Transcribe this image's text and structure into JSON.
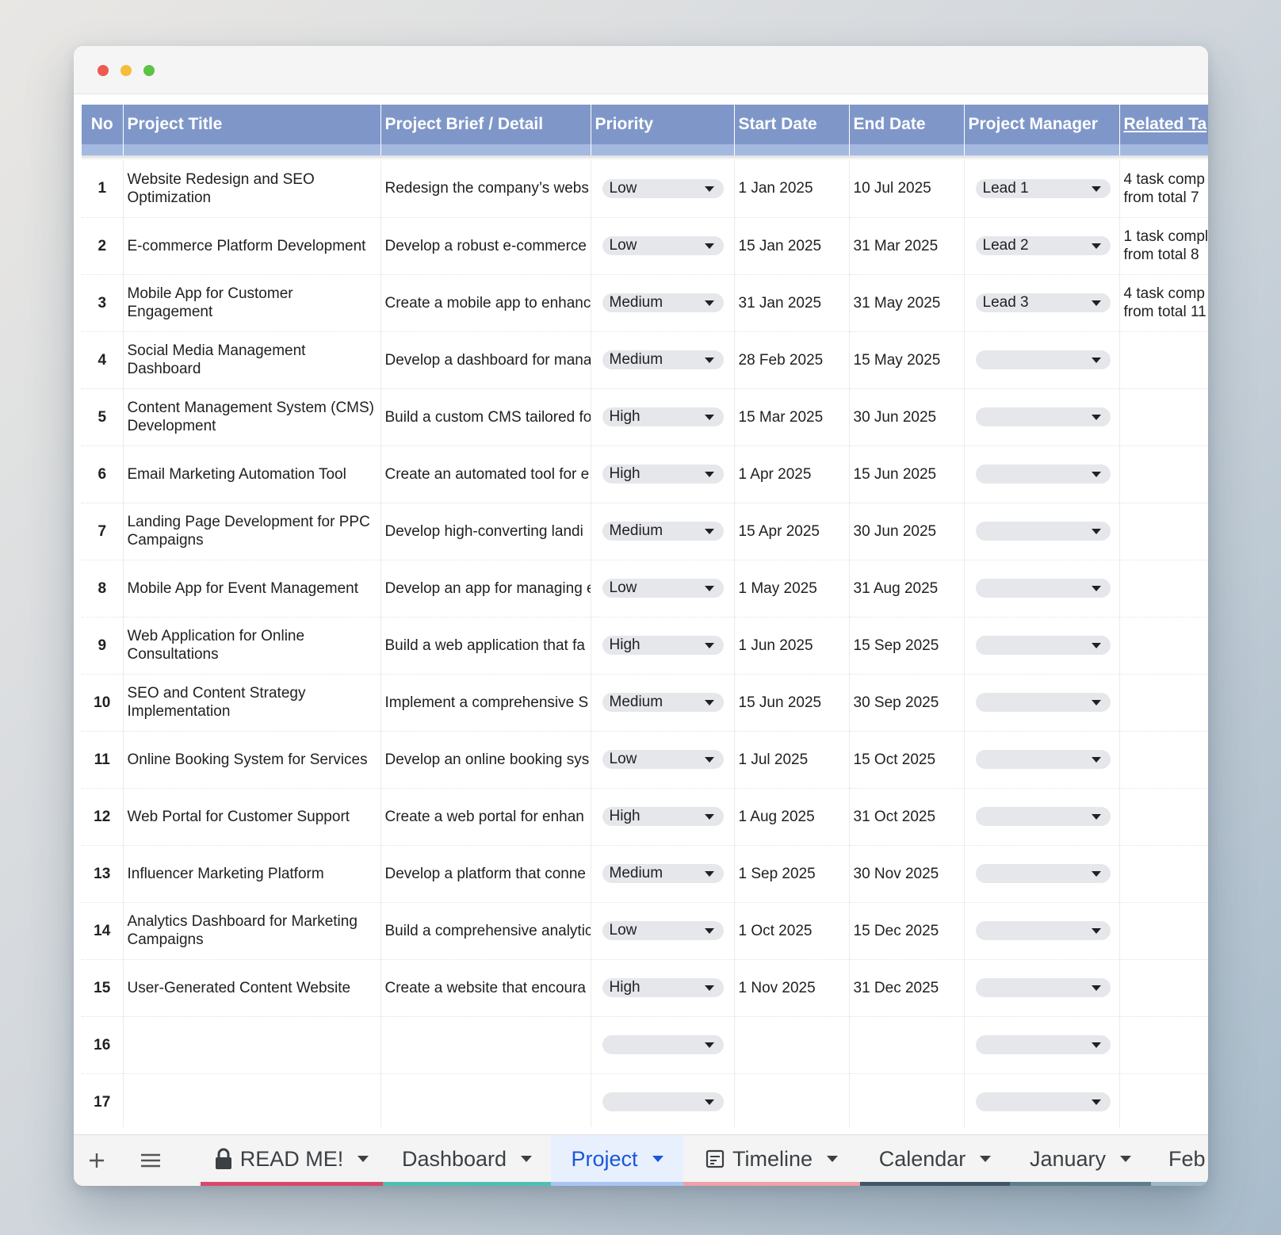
{
  "columns": {
    "no": "No",
    "title": "Project Title",
    "brief": "Project Brief / Detail",
    "priority": "Priority",
    "start": "Start Date",
    "end": "End Date",
    "manager": "Project Manager",
    "related": "Related Ta"
  },
  "rows": [
    {
      "no": "1",
      "title": "Website Redesign and SEO Optimization",
      "brief": "Redesign the company’s webs",
      "priority": "Low",
      "start": "1 Jan 2025",
      "end": "10 Jul 2025",
      "manager": "Lead 1",
      "rel1": "4 task comp",
      "rel2": "from total 7"
    },
    {
      "no": "2",
      "title": "E-commerce Platform Development",
      "brief": "Develop a robust e-commerce",
      "priority": "Low",
      "start": "15 Jan 2025",
      "end": "31 Mar 2025",
      "manager": "Lead 2",
      "rel1": "1 task compl",
      "rel2": "from total 8"
    },
    {
      "no": "3",
      "title": "Mobile App for Customer Engagement",
      "brief": "Create a mobile app to enhanc",
      "priority": "Medium",
      "start": "31 Jan 2025",
      "end": "31 May 2025",
      "manager": "Lead 3",
      "rel1": "4 task comp",
      "rel2": "from total 11"
    },
    {
      "no": "4",
      "title": "Social Media Management Dashboard",
      "brief": "Develop a dashboard for mana",
      "priority": "Medium",
      "start": "28 Feb 2025",
      "end": "15 May 2025",
      "manager": "",
      "rel1": "",
      "rel2": ""
    },
    {
      "no": "5",
      "title": "Content Management System (CMS) Development",
      "brief": "Build a custom CMS tailored fo",
      "priority": "High",
      "start": "15 Mar 2025",
      "end": "30 Jun 2025",
      "manager": "",
      "rel1": "",
      "rel2": ""
    },
    {
      "no": "6",
      "title": "Email Marketing Automation Tool",
      "brief": "Create an automated tool for e",
      "priority": "High",
      "start": "1 Apr 2025",
      "end": "15 Jun 2025",
      "manager": "",
      "rel1": "",
      "rel2": ""
    },
    {
      "no": "7",
      "title": "Landing Page Development for PPC Campaigns",
      "brief": "Develop high-converting landi",
      "priority": "Medium",
      "start": "15 Apr 2025",
      "end": "30 Jun 2025",
      "manager": "",
      "rel1": "",
      "rel2": ""
    },
    {
      "no": "8",
      "title": "Mobile App for Event Management",
      "brief": "Develop an app for managing e",
      "priority": "Low",
      "start": "1 May 2025",
      "end": "31 Aug 2025",
      "manager": "",
      "rel1": "",
      "rel2": ""
    },
    {
      "no": "9",
      "title": "Web Application for Online Consultations",
      "brief": "Build a web application that fa",
      "priority": "High",
      "start": "1 Jun 2025",
      "end": "15 Sep 2025",
      "manager": "",
      "rel1": "",
      "rel2": ""
    },
    {
      "no": "10",
      "title": "SEO and Content Strategy Implementation",
      "brief": "Implement a comprehensive S",
      "priority": "Medium",
      "start": "15 Jun 2025",
      "end": "30 Sep 2025",
      "manager": "",
      "rel1": "",
      "rel2": ""
    },
    {
      "no": "11",
      "title": "Online Booking System for Services",
      "brief": "Develop an online booking sys",
      "priority": "Low",
      "start": "1 Jul 2025",
      "end": "15 Oct 2025",
      "manager": "",
      "rel1": "",
      "rel2": ""
    },
    {
      "no": "12",
      "title": "Web Portal for Customer Support",
      "brief": "Create a web portal for enhan",
      "priority": "High",
      "start": "1 Aug 2025",
      "end": "31 Oct 2025",
      "manager": "",
      "rel1": "",
      "rel2": ""
    },
    {
      "no": "13",
      "title": "Influencer Marketing Platform",
      "brief": "Develop a platform that conne",
      "priority": "Medium",
      "start": "1 Sep 2025",
      "end": "30 Nov 2025",
      "manager": "",
      "rel1": "",
      "rel2": ""
    },
    {
      "no": "14",
      "title": "Analytics Dashboard for Marketing Campaigns",
      "brief": "Build a comprehensive analytic",
      "priority": "Low",
      "start": "1 Oct 2025",
      "end": "15 Dec 2025",
      "manager": "",
      "rel1": "",
      "rel2": ""
    },
    {
      "no": "15",
      "title": "User-Generated Content Website",
      "brief": "Create a website that encoura",
      "priority": "High",
      "start": "1 Nov 2025",
      "end": "31 Dec 2025",
      "manager": "",
      "rel1": "",
      "rel2": ""
    },
    {
      "no": "16",
      "title": "",
      "brief": "",
      "priority": "",
      "start": "",
      "end": "",
      "manager": "",
      "rel1": "",
      "rel2": ""
    },
    {
      "no": "17",
      "title": "",
      "brief": "",
      "priority": "",
      "start": "",
      "end": "",
      "manager": "",
      "rel1": "",
      "rel2": ""
    }
  ],
  "tabs": [
    {
      "label": "READ ME!",
      "icon": "lock-icon",
      "color": "#d9486a",
      "active": false
    },
    {
      "label": "Dashboard",
      "icon": "",
      "color": "#4fbfb3",
      "active": false
    },
    {
      "label": "Project",
      "icon": "",
      "color": "#a9c4f5",
      "active": true
    },
    {
      "label": "Timeline",
      "icon": "form-icon",
      "color": "#f0a0a8",
      "active": false
    },
    {
      "label": "Calendar",
      "icon": "",
      "color": "#3f5568",
      "active": false
    },
    {
      "label": "January",
      "icon": "",
      "color": "#607d8b",
      "active": false
    },
    {
      "label": "Feb",
      "icon": "",
      "color": "#9fb8c8",
      "active": false
    }
  ],
  "colors": {
    "header_bg": "#7f97c8",
    "subheader_bg": "#a3b9e0",
    "active_tab_text": "#1a56db",
    "chip_bg": "#e5e7eb"
  }
}
